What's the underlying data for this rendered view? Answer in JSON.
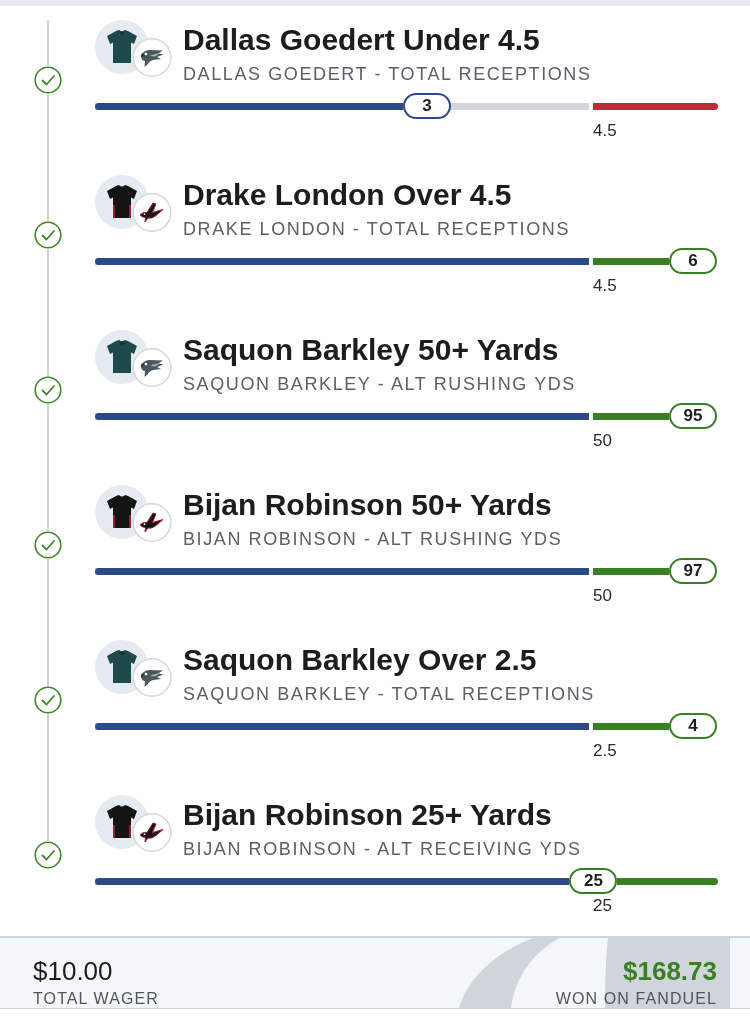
{
  "legs": [
    {
      "kind": "eagle",
      "title": "Dallas Goedert Under 4.5",
      "market": "DALLAS GOEDERT - TOTAL RECEPTIONS",
      "color": "#c1283b",
      "level": 0.533,
      "result": "3",
      "line": "4.5",
      "won": true
    },
    {
      "kind": "falcon",
      "title": "Drake London Over 4.5",
      "market": "DRAKE LONDON - TOTAL RECEPTIONS",
      "color": "#3b7f24",
      "level": 0.96,
      "result": "6",
      "line": "4.5",
      "won": true
    },
    {
      "kind": "eagle",
      "title": "Saquon Barkley 50+ Yards",
      "market": "SAQUON BARKLEY - ALT RUSHING YDS",
      "color": "#3b7f24",
      "level": 0.96,
      "result": "95",
      "line": "50",
      "won": true
    },
    {
      "kind": "falcon",
      "title": "Bijan Robinson 50+ Yards",
      "market": "BIJAN ROBINSON - ALT RUSHING YDS",
      "color": "#3b7f24",
      "level": 0.96,
      "result": "97",
      "line": "50",
      "won": true
    },
    {
      "kind": "eagle",
      "title": "Saquon Barkley Over 2.5",
      "market": "SAQUON BARKLEY - TOTAL RECEPTIONS",
      "color": "#3b7f24",
      "level": 0.96,
      "result": "4",
      "line": "2.5",
      "won": true
    },
    {
      "kind": "falcon",
      "title": "Bijan Robinson 25+ Yards",
      "market": "BIJAN ROBINSON - ALT RECEIVING YDS",
      "color": "#3b7f24",
      "level": 0.8,
      "result": "25",
      "line": "25",
      "won": true
    }
  ],
  "footer": {
    "wager": "$10.00",
    "wager_label": "TOTAL WAGER",
    "payout": "$168.73",
    "payout_label": "WON ON FANDUEL"
  }
}
